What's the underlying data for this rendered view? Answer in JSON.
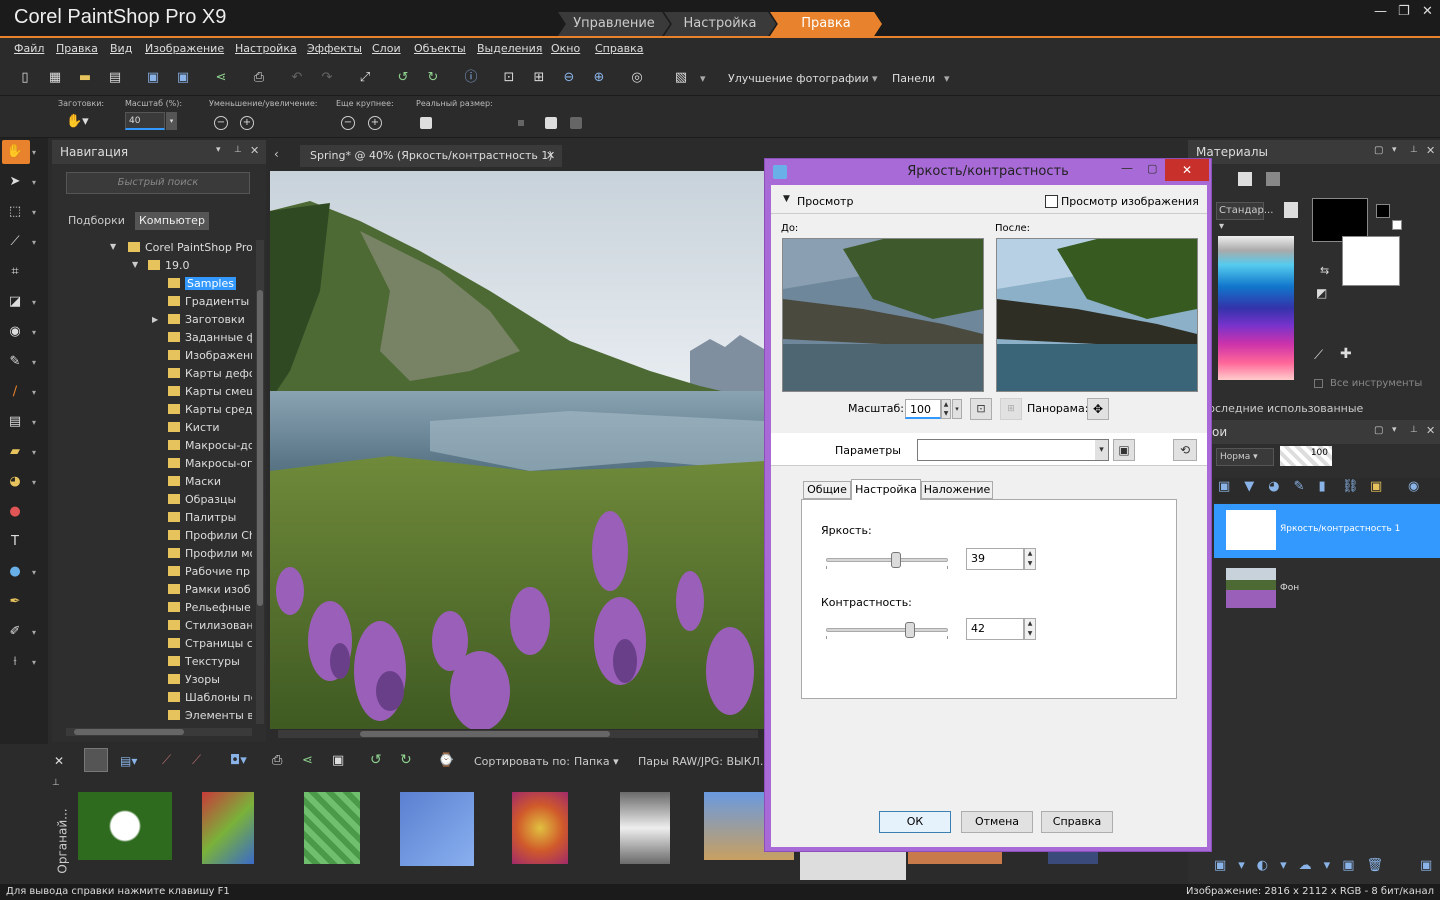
{
  "app": {
    "title": "Corel PaintShop Pro X9"
  },
  "workspace_tabs": [
    "Управление",
    "Настройка",
    "Правка"
  ],
  "menu": [
    "Файл",
    "Правка",
    "Вид",
    "Изображение",
    "Настройка",
    "Эффекты",
    "Слои",
    "Объекты",
    "Выделения",
    "Окно",
    "Справка"
  ],
  "toolbar": {
    "enhance_label": "Улучшение фотографии",
    "panels_label": "Панели"
  },
  "options": {
    "presets_label": "Заготовки:",
    "zoom_label": "Масштаб (%):",
    "zoom_value": "40",
    "zoom_inout_label": "Уменьшение/увеличение:",
    "more_label": "Еще крупнее:",
    "actual_label": "Реальный размер:"
  },
  "nav": {
    "title": "Навигация",
    "search_placeholder": "Быстрый поиск",
    "tabs": [
      "Подборки",
      "Компьютер"
    ],
    "root": "Corel PaintShop Pro",
    "version": "19.0",
    "folders": [
      "Samples",
      "Градиенты",
      "Заготовки",
      "Заданные ф",
      "Изображени",
      "Карты дефо",
      "Карты смещ",
      "Карты средь",
      "Кисти",
      "Макросы-до",
      "Макросы-ог",
      "Маски",
      "Образцы",
      "Палитры",
      "Профили Сh",
      "Профили мо",
      "Рабочие пр",
      "Рамки изоб",
      "Рельефные",
      "Стилизовани",
      "Страницы сп",
      "Текстуры",
      "Узоры",
      "Шаблоны пе",
      "Элементы ві"
    ]
  },
  "document": {
    "tab_label": "Spring* @  40% (Яркость/контрастность 1)"
  },
  "organizer": {
    "side_label": "Органай...",
    "sort_label": "Сортировать по:",
    "sort_value": "Папка",
    "raw_label": "Пары RAW/JPG: ВЫКЛ."
  },
  "materials": {
    "title": "Материалы",
    "palette_select": "Стандар...",
    "all_tools": "Все инструменты",
    "recent": "Последние использованные"
  },
  "layers": {
    "title": "Слои",
    "blend": "Норма",
    "opacity": "100",
    "items": [
      "Яркость/контрастность 1",
      "Фон"
    ]
  },
  "dialog": {
    "title": "Яркость/контрастность",
    "preview_label": "Просмотр",
    "preview_image_label": "Просмотр изображения",
    "before_label": "До:",
    "after_label": "После:",
    "zoom_label": "Масштаб:",
    "zoom_value": "100",
    "pan_label": "Панорама:",
    "params_label": "Параметры",
    "tabs": [
      "Общие",
      "Настройка",
      "Наложение"
    ],
    "brightness_label": "Яркость:",
    "brightness_value": "39",
    "brightness_level": 0.57,
    "contrast_label": "Контрастность:",
    "contrast_value": "42",
    "contrast_level": 0.69,
    "ok": "ОК",
    "cancel": "Отмена",
    "help": "Справка"
  },
  "status": {
    "left": "Для вывода справки нажмите клавишу F1",
    "right": "Изображение:  2816 x 2112 x RGB - 8 бит/канал"
  },
  "colors": {
    "accent": "#e8822c",
    "dialog_frame": "#a86ad6",
    "selection": "#3399ff"
  }
}
